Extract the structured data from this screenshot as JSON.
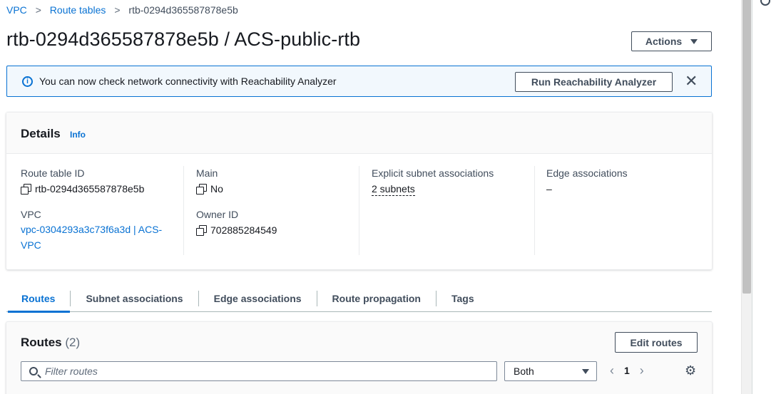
{
  "breadcrumb": {
    "items": [
      "VPC",
      "Route tables",
      "rtb-0294d365587878e5b"
    ]
  },
  "page": {
    "title": "rtb-0294d365587878e5b / ACS-public-rtb",
    "actions_label": "Actions"
  },
  "flash": {
    "message": "You can now check network connectivity with Reachability Analyzer",
    "button_label": "Run Reachability Analyzer",
    "close_symbol": "✕",
    "icon": "info-icon"
  },
  "details": {
    "title": "Details",
    "info_label": "Info",
    "fields": {
      "route_table_id_label": "Route table ID",
      "route_table_id_value": "rtb-0294d365587878e5b",
      "vpc_label": "VPC",
      "vpc_value_line1": "vpc-0304293a3c73f6a3d | ACS-",
      "vpc_value_line2": "VPC",
      "main_label": "Main",
      "main_value": "No",
      "owner_id_label": "Owner ID",
      "owner_id_value": "702885284549",
      "explicit_label": "Explicit subnet associations",
      "explicit_value": "2 subnets",
      "edge_label": "Edge associations",
      "edge_value": "–"
    }
  },
  "tabs": [
    {
      "label": "Routes",
      "active": true
    },
    {
      "label": "Subnet associations",
      "active": false
    },
    {
      "label": "Edge associations",
      "active": false
    },
    {
      "label": "Route propagation",
      "active": false
    },
    {
      "label": "Tags",
      "active": false
    }
  ],
  "routes": {
    "title": "Routes",
    "count": "(2)",
    "edit_label": "Edit routes",
    "filter_placeholder": "Filter routes",
    "select_value": "Both",
    "page_number": "1",
    "prev_symbol": "‹",
    "next_symbol": "›",
    "settings_icon": "gear-icon"
  },
  "colors": {
    "accent": "#0972d3",
    "text": "#16191f",
    "muted": "#414d5c"
  }
}
